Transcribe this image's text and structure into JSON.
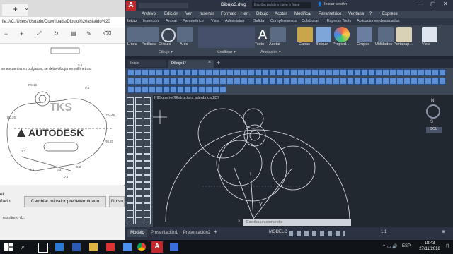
{
  "browser": {
    "address": "ile:///C:/Users/Usuario/Downloads/Dibujo%20asistido%20",
    "note": "se encuentra en pulgadas, se debe dibujar en milímetros.",
    "watermark_tks": "TKS",
    "watermark_autodesk": "AUTODESK",
    "dims": [
      "R0.15",
      "R0.25",
      "R0.25",
      "R0.25",
      "0.6",
      "0.3",
      "0.4",
      "0.4",
      "1.7",
      "2.3",
      "0.2"
    ],
    "dialog_left_top": "el",
    "dialog_left_bottom": "ñado",
    "btn_change_default": "Cambiar mi valor predeterminado",
    "btn_no": "No vo",
    "footer": "escritorio d..."
  },
  "acad": {
    "title": "Dibujo3.dwg",
    "search_placeholder": "Escriba palabra clave o frase",
    "signin": "Iniciar sesión",
    "menu": [
      "Archivo",
      "Edición",
      "Ver",
      "Insertar",
      "Formato",
      "Herr.",
      "Dibujo",
      "Acotar",
      "Modificar",
      "Parametrico",
      "Ventana",
      "?",
      "Express"
    ],
    "ribbon_tabs": [
      "Inicio",
      "Inserción",
      "Anotar",
      "Paramétrico",
      "Vista",
      "Administrar",
      "Salida",
      "Complementos",
      "Colaborar",
      "Express Tools",
      "Aplicaciones destacadas"
    ],
    "ribbon_tools": [
      "Línea",
      "Polilínea",
      "Círculo",
      "Arco",
      "Texto",
      "Acotar",
      "Capas",
      "Bloque",
      "Propied...",
      "Grupos",
      "Utilidades",
      "Portapap...",
      "Vista"
    ],
    "ribbon_groups": [
      "Dibujo ▾",
      "Modificar ▾",
      "Anotación ▾"
    ],
    "file_tabs": [
      "Inicio",
      "Dibujo1*"
    ],
    "viewport_label": "[-][Superior][Estructura alámbrica 2D]",
    "viewcube_top": "N",
    "viewcube_center": "S",
    "wcs": "SCU",
    "cmd_placeholder": "Escriba un comando",
    "layout_tabs": [
      "Modelo",
      "Presentación1",
      "Presentación2"
    ],
    "status_model": "MODELO",
    "scale": "1:1"
  },
  "taskbar": {
    "lang": "ESP",
    "time": "18:43",
    "date": "27/11/2018"
  }
}
